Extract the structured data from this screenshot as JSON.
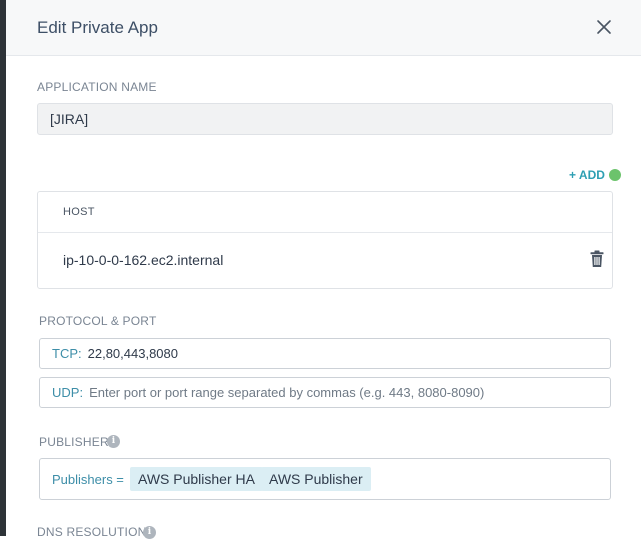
{
  "dialog": {
    "title": "Edit Private App",
    "close_icon": "close-icon"
  },
  "application_name": {
    "label": "APPLICATION NAME",
    "value": "[JIRA]"
  },
  "hosts": {
    "add_label": "+ ADD",
    "status_color": "#6cc36c",
    "column_header": "HOST",
    "rows": [
      {
        "host": "ip-10-0-0-162.ec2.internal",
        "delete_icon": "trash-icon"
      }
    ]
  },
  "protocol_port": {
    "label": "PROTOCOL & PORT",
    "tcp_prefix": "TCP:",
    "tcp_value": "22,80,443,8080",
    "udp_prefix": "UDP:",
    "udp_placeholder": "Enter port or port range separated by commas (e.g. 443, 8080-8090)"
  },
  "publisher": {
    "label": "PUBLISHER",
    "info_icon": "info-icon",
    "prefix": "Publishers =",
    "selected": [
      "AWS Publisher HA",
      "AWS Publisher"
    ]
  },
  "dns_resolution": {
    "label": "DNS RESOLUTION",
    "info_icon": "info-icon"
  },
  "colors": {
    "accent": "#2d9fb3",
    "chip_bg": "#dbeef4",
    "title": "#3d4f66"
  }
}
